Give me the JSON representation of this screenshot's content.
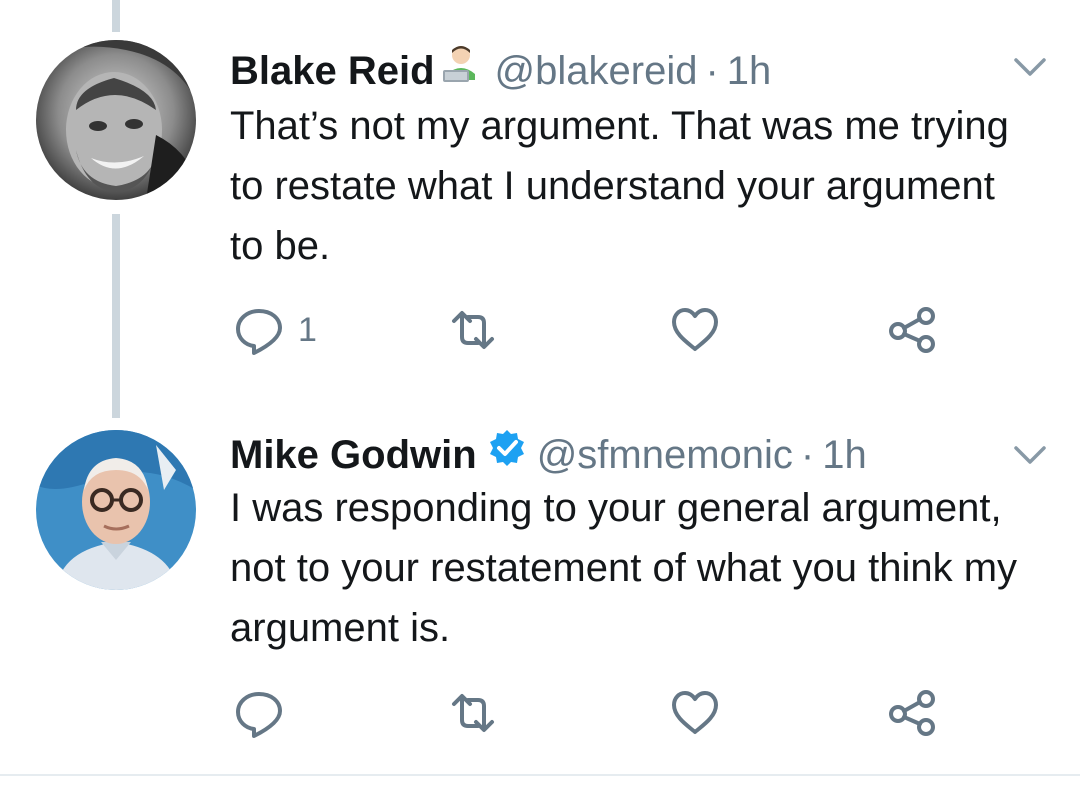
{
  "tweets": [
    {
      "name": "Blake Reid",
      "badge": "man-technologist-emoji",
      "handle": "@blakereid",
      "separator": "·",
      "time": "1h",
      "text": "That’s not my argument. That was me trying to restate what I understand your argument to be.",
      "actions": {
        "reply_count": "1",
        "retweet_count": "",
        "like_count": ""
      }
    },
    {
      "name": "Mike Godwin",
      "badge": "verified-badge",
      "handle": "@sfmnemonic",
      "separator": "·",
      "time": "1h",
      "text": "I was responding to your general argument, not to your restatement of what you think my argument is.",
      "actions": {
        "reply_count": "",
        "retweet_count": "",
        "like_count": ""
      }
    }
  ],
  "colors": {
    "text": "#14171a",
    "muted": "#657786",
    "verified": "#1da1f2",
    "thread_line": "#ccd6dd",
    "icon": "#657786"
  }
}
